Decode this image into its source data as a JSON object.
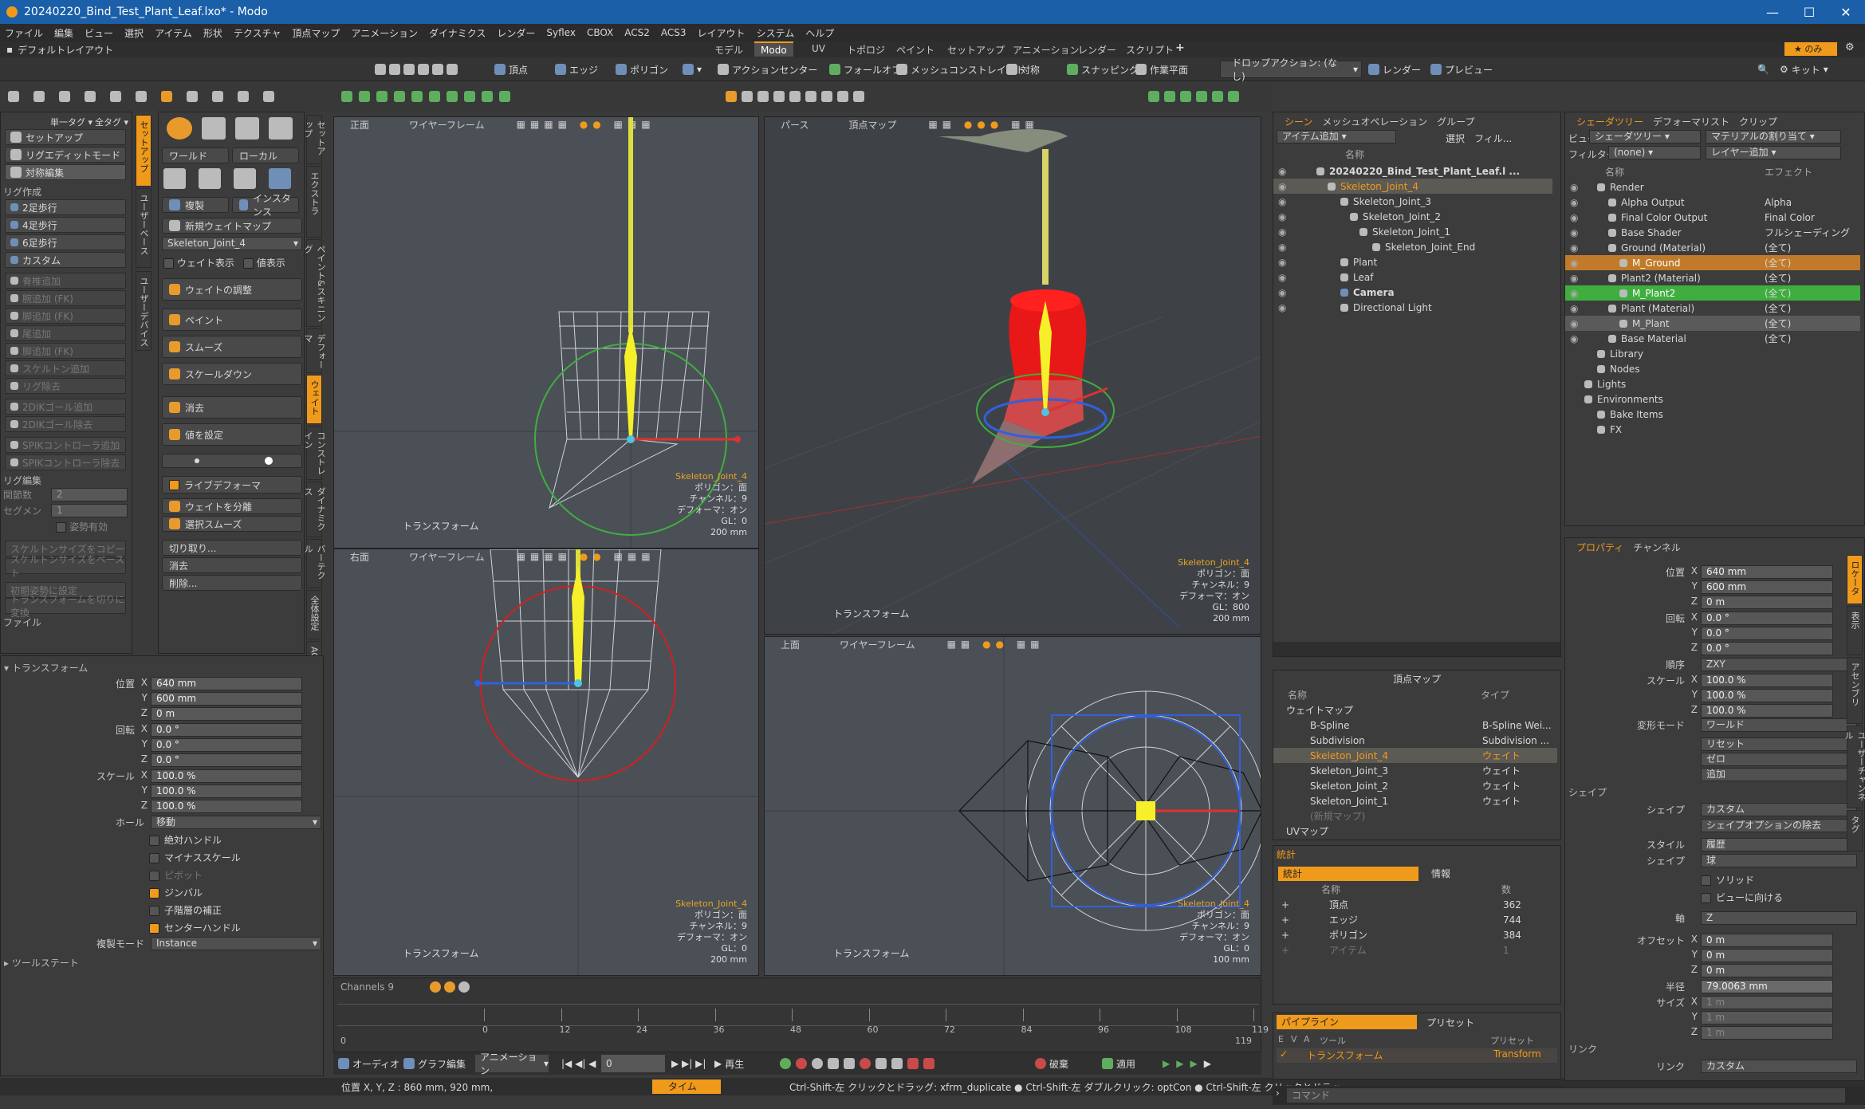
{
  "window": {
    "title": "20240220_Bind_Test_Plant_Leaf.lxo* - Modo"
  },
  "menu": [
    "ファイル",
    "編集",
    "ビュー",
    "選択",
    "アイテム",
    "形状",
    "テクスチャ",
    "頂点マップ",
    "アニメーション",
    "ダイナミクス",
    "レンダー",
    "Syflex",
    "CBOX",
    "ACS2",
    "ACS3",
    "レイアウト",
    "システム",
    "ヘルプ"
  ],
  "layout": {
    "name": "デフォルトレイアウト",
    "tabs": [
      "モデル",
      "Modo",
      "UV",
      "トポロジ",
      "ペイント",
      "セットアップ",
      "アニメーション",
      "レンダー",
      "スクリプト"
    ],
    "active_tab": "Modo",
    "right_label": "のみ",
    "plus": "+"
  },
  "toolbar": {
    "vertex": "頂点",
    "edge": "エッジ",
    "polygon": "ポリゴン",
    "action_center": "アクションセンター",
    "falloff": "フォールオフ",
    "mesh_constraint": "メッシュコンストレイント",
    "symmetry": "対称",
    "snapping": "スナッピング",
    "workplane": "作業平面",
    "drop_action": "ドロップアクション: (なし)",
    "render": "レンダー",
    "preview": "プレビュー",
    "kit": "キット"
  },
  "left": {
    "header_left": "単一タグ ▾",
    "header_right": "全タグ ▾",
    "buttons": [
      "セットアップ",
      "リグエディットモード",
      "対称編集"
    ],
    "section_rig": "リグ作成",
    "rig_items": [
      "2足歩行",
      "4足歩行",
      "6足歩行",
      "カスタム",
      "脊椎追加",
      "腕追加 (FK)",
      "脚追加 (FK)",
      "尾追加",
      "脚追加 (FK)",
      "スケルトン追加",
      "リグ除去",
      "2DIKゴール追加",
      "2DIKゴール除去",
      "SPIKコントローラ追加",
      "SPIKコントローラ除去"
    ],
    "section_edit": "リグ編集",
    "joint_count_label": "関節数",
    "joint_count": "2",
    "segment_label": "セグメン",
    "segment": "1",
    "pose_label": "姿勢有効",
    "copy_size": "スケルトンサイズをコピー",
    "paste_size": "スケルトンサイズをペースト",
    "init_reset": "初期姿勢に設定",
    "transform_reset": "トランスフォームを切りに変換",
    "section_file": "ファイル",
    "vtabs": [
      "セットアップ",
      "ユーザーベース",
      "ユーザーデバイス"
    ],
    "tools": {
      "world": "ワールド",
      "local": "ローカル",
      "duplicate": "複製",
      "instance": "インスタンス",
      "new_weight_map": "新規ウェイトマップ",
      "joint": "Skeleton_Joint_4",
      "show_weight": "ウェイト表示",
      "show_value": "値表示",
      "adjust_weight": "ウェイトの調整",
      "paint": "ペイント",
      "smooth": "スムーズ",
      "scale_down": "スケールダウン",
      "erase": "消去",
      "set_value": "値を設定",
      "live_deform": "ライブデフォーマ",
      "split_weight": "ウェイトを分離",
      "select_smooth": "選択スムーズ",
      "cut": "切り取り...",
      "delete": "消去",
      "remove": "削除..."
    },
    "tools_vtabs": [
      "セットアップ",
      "エクストラ",
      "ペイント&スキニング",
      "デフォーマ",
      "ウェイト",
      "コンストレイン",
      "ダイナミクス",
      "バーテクル",
      "全体設定",
      "ACS3"
    ],
    "transform": {
      "title": "トランスフォーム",
      "pos_label": "位置",
      "pos": [
        "640 mm",
        "600 mm",
        "0 m"
      ],
      "rot_label": "回転",
      "rot": [
        "0.0 °",
        "0.0 °",
        "0.0 °"
      ],
      "scale_label": "スケール",
      "scale": [
        "100.0 %",
        "100.0 %",
        "100.0 %"
      ],
      "hold_label": "ホール",
      "hold": "移動",
      "opts": [
        "絶対ハンドル",
        "マイナススケール",
        "ピボット",
        "ジンバル",
        "子階層の補正",
        "センターハンドル"
      ],
      "dup_mode_label": "複製モード",
      "dup_mode": "Instance",
      "tool_state": "ツールステート",
      "axis": [
        "X",
        "Y",
        "Z"
      ]
    }
  },
  "viewports": {
    "front": {
      "label": "正面",
      "shade": "ワイヤーフレーム",
      "footer": "トランスフォーム",
      "info": [
        "Skeleton_Joint_4",
        "ポリゴン：面",
        "チャンネル：9",
        "デフォーマ：オン",
        "GL：0",
        "200 mm"
      ]
    },
    "persp": {
      "label": "パース",
      "shade": "頂点マップ",
      "footer": "トランスフォーム",
      "info": [
        "Skeleton_Joint_4",
        "ポリゴン：面",
        "チャンネル：9",
        "デフォーマ：オン",
        "GL：800",
        "200 mm"
      ]
    },
    "right": {
      "label": "右面",
      "shade": "ワイヤーフレーム",
      "footer": "トランスフォーム",
      "info": [
        "Skeleton_Joint_4",
        "ポリゴン：面",
        "チャンネル：9",
        "デフォーマ：オン",
        "GL：0",
        "200 mm"
      ]
    },
    "top": {
      "label": "上面",
      "shade": "ワイヤーフレーム",
      "footer": "トランスフォーム",
      "info": [
        "Skeleton_Joint_4",
        "ポリゴン：面",
        "チャンネル：9",
        "デフォーマ：オン",
        "GL：0",
        "100 mm"
      ]
    }
  },
  "timeline": {
    "channels": "Channels 9",
    "ticks": [
      "0",
      "12",
      "24",
      "36",
      "48",
      "60",
      "72",
      "84",
      "96",
      "108",
      "119"
    ],
    "start": "0",
    "end": "119",
    "audio": "オーディオ",
    "graph": "グラフ編集",
    "anim": "アニメーション",
    "frame": "0",
    "play": "再生",
    "key": "破棄",
    "apply": "適用"
  },
  "status": {
    "pos": "位置 X, Y, Z :  860 mm, 920 mm,",
    "time": "タイム",
    "hint": "Ctrl-Shift-左 クリックとドラッグ: xfrm_duplicate ● Ctrl-Shift-左 ダブルクリック: optCon ● Ctrl-Shift-左 クリックとドラッ...",
    "command": "コマンド"
  },
  "scene": {
    "tabs": [
      "シーン",
      "メッシュオペレーション",
      "グループ"
    ],
    "add_item": "アイテム追加",
    "select": "選択",
    "filter": "フィル...",
    "col_name": "名称",
    "items": [
      "20240220_Bind_Test_Plant_Leaf.l ...",
      "Skeleton_Joint_4",
      "Skeleton_Joint_3",
      "Skeleton_Joint_2",
      "Skeleton_Joint_1",
      "Skeleton_Joint_End",
      "Plant",
      "Leaf",
      "Camera",
      "Directional Light"
    ]
  },
  "vmap": {
    "title": "頂点マップ",
    "col_name": "名称",
    "col_type": "タイプ",
    "rows": [
      [
        "ウェイトマップ",
        ""
      ],
      [
        "B-Spline",
        "B-Spline Wei..."
      ],
      [
        "Subdivision",
        "Subdivision ..."
      ],
      [
        "Skeleton_Joint_4",
        "ウェイト"
      ],
      [
        "Skeleton_Joint_3",
        "ウェイト"
      ],
      [
        "Skeleton_Joint_2",
        "ウェイト"
      ],
      [
        "Skeleton_Joint_1",
        "ウェイト"
      ],
      [
        "(新規マップ)",
        ""
      ],
      [
        "UVマップ",
        ""
      ]
    ]
  },
  "stats": {
    "tabs": [
      "統計",
      "情報"
    ],
    "col_name": "名称",
    "col_num": "数",
    "rows": [
      [
        "頂点",
        "362"
      ],
      [
        "エッジ",
        "744"
      ],
      [
        "ポリゴン",
        "384"
      ],
      [
        "アイテム",
        "1"
      ]
    ]
  },
  "pipeline": {
    "tabs": [
      "パイプライン",
      "プリセット"
    ],
    "cols": [
      "E",
      "V",
      "A",
      "ツール",
      "プリセット"
    ],
    "row": [
      "トランスフォーム",
      "Transform"
    ]
  },
  "shader": {
    "tabs": [
      "シェーダツリー",
      "デフォーマリスト",
      "クリップ"
    ],
    "view_label": "ビュー",
    "view": "シェーダツリー",
    "assign": "マテリアルの割り当て",
    "filter_label": "フィルター",
    "filter": "(none)",
    "add_layer": "レイヤー追加",
    "col_name": "名称",
    "col_effect": "エフェクト",
    "rows": [
      [
        "Render",
        ""
      ],
      [
        "Alpha Output",
        "Alpha"
      ],
      [
        "Final Color Output",
        "Final Color"
      ],
      [
        "Base Shader",
        "フルシェーディング"
      ],
      [
        "Ground (Material)",
        "(全て)"
      ],
      [
        "M_Ground",
        "(全て)"
      ],
      [
        "Plant2 (Material)",
        "(全て)"
      ],
      [
        "M_Plant2",
        "(全て)"
      ],
      [
        "Plant (Material)",
        "(全て)"
      ],
      [
        "M_Plant",
        "(全て)"
      ],
      [
        "Base Material",
        "(全て)"
      ],
      [
        "Library",
        ""
      ],
      [
        "Nodes",
        ""
      ],
      [
        "Lights",
        ""
      ],
      [
        "Environments",
        ""
      ],
      [
        "Bake Items",
        ""
      ],
      [
        "FX",
        ""
      ]
    ]
  },
  "props": {
    "tabs": [
      "プロパティ",
      "チャンネル"
    ],
    "pos_label": "位置",
    "pos": [
      "640 mm",
      "600 mm",
      "0 m"
    ],
    "rot_label": "回転",
    "rot": [
      "0.0 °",
      "0.0 °",
      "0.0 °"
    ],
    "order_label": "順序",
    "order": "ZXY",
    "scale_label": "スケール",
    "scale": [
      "100.0 %",
      "100.0 %",
      "100.0 %"
    ],
    "deform_label": "変形モード",
    "deform": "ワールド",
    "reset": "リセット",
    "zero": "ゼロ",
    "add": "追加",
    "shape_section": "シェイプ",
    "shape_label": "シェイプ",
    "shape": "カスタム",
    "shape_remove": "シェイプオプションの除去",
    "style_label": "スタイル",
    "style": "履歴",
    "shape2_label": "シェイプ",
    "shape2": "球",
    "solid": "ソリッド",
    "view_face": "ビューに向ける",
    "axis_label": "軸",
    "axis": "Z",
    "offset_label": "オフセット",
    "offset": [
      "0 m",
      "0 m",
      "0 m"
    ],
    "radius_label": "半径",
    "radius": "79.0063 mm",
    "size_label": "サイズ",
    "size": [
      "1 m",
      "1 m",
      "1 m"
    ],
    "link_section": "リンク",
    "link_label": "リンク",
    "link": "カスタム",
    "axes": [
      "X",
      "Y",
      "Z"
    ],
    "vtabs": [
      "ロケータ",
      "表示",
      "アセンブリ",
      "ユーザーチャンネル",
      "タグ"
    ]
  },
  "colors": {
    "accent": "#f09a1c",
    "title": "#1a5fa8",
    "viewport": "#4b5057",
    "selected": "#f09a1c",
    "green": "#3fae3f"
  }
}
